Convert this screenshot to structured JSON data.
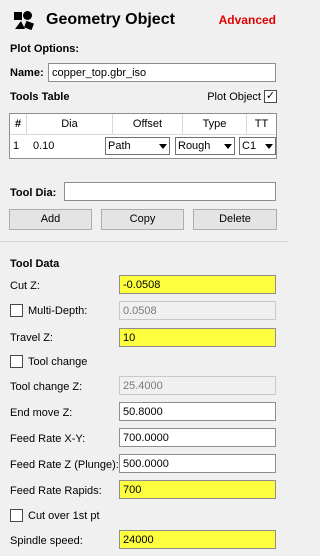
{
  "header": {
    "title": "Geometry Object",
    "advanced_label": "Advanced"
  },
  "plot_options": {
    "heading": "Plot Options:",
    "name_label": "Name:",
    "name_value": "copper_top.gbr_iso"
  },
  "tools_table": {
    "heading": "Tools Table",
    "plot_object_label": "Plot Object",
    "plot_object_checked": "✓",
    "columns": [
      "#",
      "Dia",
      "Offset",
      "Type",
      "TT"
    ],
    "row": {
      "num": "1",
      "dia": "0.10",
      "offset": "Path",
      "type": "Rough",
      "tt": "C1"
    }
  },
  "tool_dia": {
    "label": "Tool Dia:",
    "value": "",
    "add_label": "Add",
    "copy_label": "Copy",
    "delete_label": "Delete"
  },
  "tool_data": {
    "heading": "Tool Data",
    "cut_z_label": "Cut Z:",
    "cut_z_value": "-0.0508",
    "multi_depth_label": "Multi-Depth:",
    "multi_depth_value": "0.0508",
    "travel_z_label": "Travel Z:",
    "travel_z_value": "10",
    "tool_change_label": "Tool change",
    "tool_change_z_label": "Tool change Z:",
    "tool_change_z_value": "25.4000",
    "end_move_z_label": "End move Z:",
    "end_move_z_value": "50.8000",
    "feed_xy_label": "Feed Rate X-Y:",
    "feed_xy_value": "700.0000",
    "feed_z_label": "Feed Rate Z (Plunge):",
    "feed_z_value": "500.0000",
    "feed_rapids_label": "Feed Rate Rapids:",
    "feed_rapids_value": "700",
    "cut_over_label": "Cut over 1st pt",
    "spindle_label": "Spindle speed:",
    "spindle_value": "24000"
  },
  "colors": {
    "highlight": "#fdff3e",
    "advanced": "#e00000",
    "background": "#f0f0f0"
  },
  "icons": {
    "title_icon": "geometry-object-icon",
    "dropdown": "chevron-down-icon"
  }
}
